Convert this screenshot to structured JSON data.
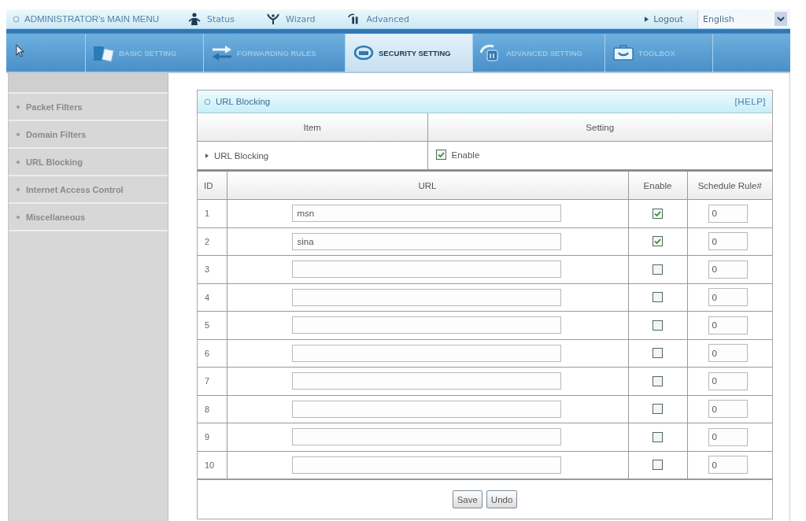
{
  "top_menu": {
    "title": "ADMINISTRATOR's MAIN MENU",
    "links": [
      {
        "label": "Status"
      },
      {
        "label": "Wizard"
      },
      {
        "label": "Advanced"
      }
    ],
    "logout": "Logout",
    "language": "English"
  },
  "tabs": [
    {
      "label": "BASIC SETTING",
      "selected": false
    },
    {
      "label": "FORWARDING RULES",
      "selected": false
    },
    {
      "label": "SECURITY SETTING",
      "selected": true
    },
    {
      "label": "ADVANCED SETTING",
      "selected": false
    },
    {
      "label": "TOOLBOX",
      "selected": false
    }
  ],
  "sidebar": {
    "items": [
      {
        "label": "Packet Filters"
      },
      {
        "label": "Domain Filters"
      },
      {
        "label": "URL Blocking"
      },
      {
        "label": "Internet Access Control"
      },
      {
        "label": "Miscellaneous"
      }
    ]
  },
  "panel": {
    "title": "URL Blocking",
    "help": "[HELP]",
    "columns": [
      "Item",
      "Setting"
    ],
    "setting": {
      "label": "URL Blocking",
      "option": "Enable",
      "checked": true
    }
  },
  "table": {
    "columns": [
      "ID",
      "URL",
      "Enable",
      "Schedule Rule#"
    ],
    "rows": [
      {
        "id": "1",
        "url": "msn",
        "enabled": true,
        "schedule": "0"
      },
      {
        "id": "2",
        "url": "sina",
        "enabled": true,
        "schedule": "0"
      },
      {
        "id": "3",
        "enabled": false,
        "schedule": "0"
      },
      {
        "id": "4",
        "enabled": false,
        "schedule": "0"
      },
      {
        "id": "5",
        "enabled": false,
        "schedule": "0"
      },
      {
        "id": "6",
        "enabled": false,
        "schedule": "0"
      },
      {
        "id": "7",
        "enabled": false,
        "schedule": "0"
      },
      {
        "id": "8",
        "enabled": false,
        "schedule": "0"
      },
      {
        "id": "9",
        "enabled": false,
        "schedule": "0"
      },
      {
        "id": "10",
        "enabled": false,
        "schedule": "0"
      }
    ]
  },
  "buttons": [
    "Save",
    "Undo"
  ]
}
